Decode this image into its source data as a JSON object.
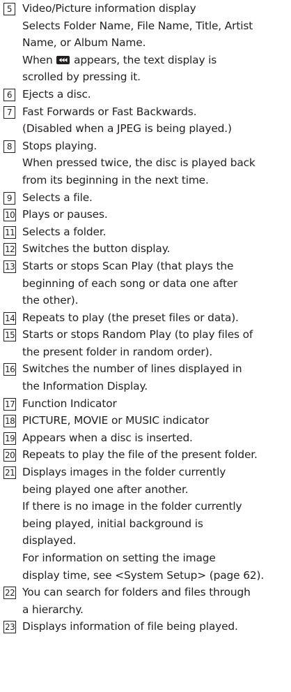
{
  "items": [
    {
      "num": "5",
      "lines": [
        "Video/Picture information display",
        "Selects Folder Name, File Name, Title, Artist",
        "Name, or Album Name."
      ],
      "scroll_line_before": "When",
      "scroll_line_after": "appears, the text display is",
      "lines_after": [
        "scrolled by pressing it."
      ],
      "icon": "scroll-text-icon"
    },
    {
      "num": "6",
      "lines": [
        "Ejects a disc."
      ]
    },
    {
      "num": "7",
      "lines": [
        "Fast Forwards or Fast Backwards.",
        "(Disabled when a JPEG is being played.)"
      ]
    },
    {
      "num": "8",
      "lines": [
        "Stops playing.",
        "When pressed twice, the disc is played back",
        "from its beginning in the next time."
      ]
    },
    {
      "num": "9",
      "lines": [
        "Selects a file."
      ]
    },
    {
      "num": "10",
      "lines": [
        "Plays or pauses."
      ]
    },
    {
      "num": "11",
      "lines": [
        "Selects a folder."
      ]
    },
    {
      "num": "12",
      "lines": [
        "Switches the button display."
      ]
    },
    {
      "num": "13",
      "lines": [
        "Starts or stops Scan Play (that plays the",
        "beginning of each song or data one after",
        "the other)."
      ]
    },
    {
      "num": "14",
      "lines": [
        "Repeats to play (the preset files or data)."
      ]
    },
    {
      "num": "15",
      "lines": [
        "Starts or stops Random Play (to play files of",
        "the present folder in random order)."
      ]
    },
    {
      "num": "16",
      "lines": [
        "Switches the number of lines displayed in",
        "the Information Display."
      ]
    },
    {
      "num": "17",
      "lines": [
        "Function Indicator"
      ]
    },
    {
      "num": "18",
      "lines": [
        "PICTURE, MOVIE or MUSIC indicator"
      ]
    },
    {
      "num": "19",
      "lines": [
        "Appears when a disc is inserted."
      ]
    },
    {
      "num": "20",
      "lines": [
        "Repeats to play the file of the present folder."
      ]
    },
    {
      "num": "21",
      "lines": [
        "Displays images in the folder currently",
        "being played one after another.",
        "If there is no image in the folder currently",
        "being played, initial background is",
        "displayed.",
        "For information on setting the image",
        "display time, see <System Setup> (page 62)."
      ]
    },
    {
      "num": "22",
      "lines": [
        "You can search for folders and files through",
        "a hierarchy."
      ]
    },
    {
      "num": "23",
      "lines": [
        "Displays information of file being played."
      ]
    }
  ]
}
